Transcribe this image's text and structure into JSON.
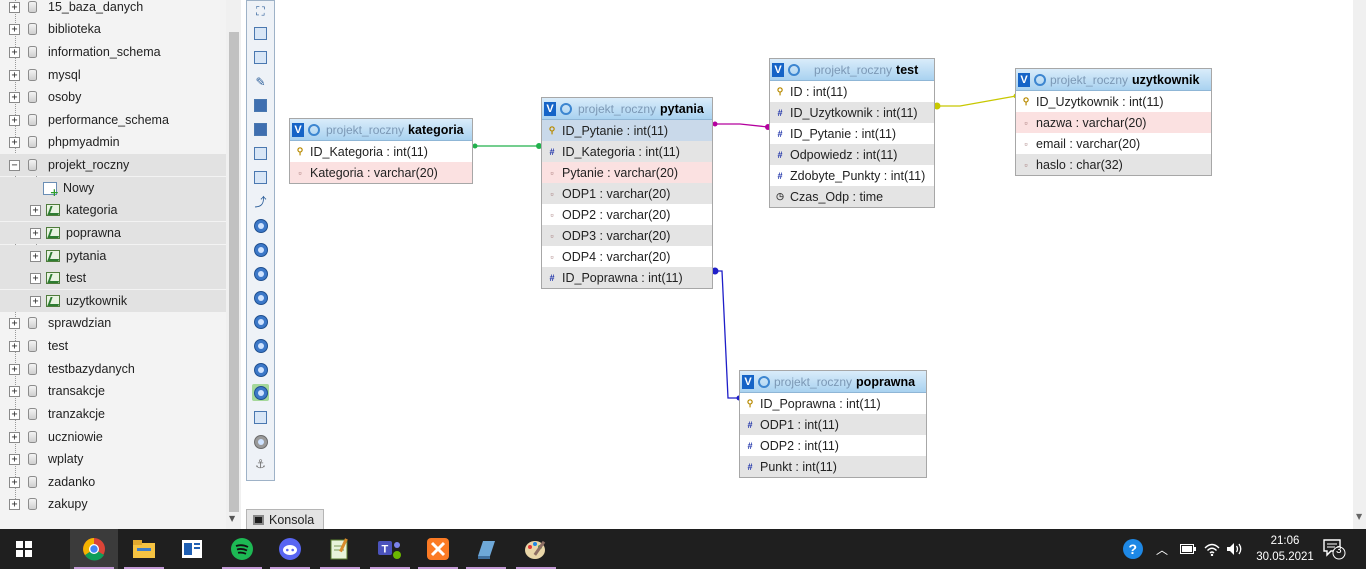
{
  "sidebar": {
    "databases_top": [
      "15_baza_danych",
      "biblioteka",
      "information_schema",
      "mysql",
      "osoby",
      "performance_schema",
      "phpmyadmin"
    ],
    "selected_db": "projekt_roczny",
    "new_label": "Nowy",
    "tables": [
      "kategoria",
      "poprawna",
      "pytania",
      "test",
      "uzytkownik"
    ],
    "databases_bottom": [
      "sprawdzian",
      "test",
      "testbazydanych",
      "transakcje",
      "tranzakcje",
      "uczniowie",
      "wplaty",
      "zadanko",
      "zakupy"
    ]
  },
  "designer": {
    "db_prefix": "projekt_roczny",
    "tables": {
      "kategoria": {
        "name": "kategoria",
        "columns": [
          "ID_Kategoria : int(11)",
          "Kategoria : varchar(20)"
        ]
      },
      "pytania": {
        "name": "pytania",
        "columns": [
          "ID_Pytanie : int(11)",
          "ID_Kategoria : int(11)",
          "Pytanie : varchar(20)",
          "ODP1 : varchar(20)",
          "ODP2 : varchar(20)",
          "ODP3 : varchar(20)",
          "ODP4 : varchar(20)",
          "ID_Poprawna : int(11)"
        ]
      },
      "test": {
        "name": "test",
        "columns": [
          "ID : int(11)",
          "ID_Uzytkownik : int(11)",
          "ID_Pytanie : int(11)",
          "Odpowiedz : int(11)",
          "Zdobyte_Punkty : int(11)",
          "Czas_Odp : time"
        ]
      },
      "uzytkownik": {
        "name": "uzytkownik",
        "columns": [
          "ID_Uzytkownik : int(11)",
          "nazwa : varchar(20)",
          "email : varchar(20)",
          "haslo : char(32)"
        ]
      },
      "poprawna": {
        "name": "poprawna",
        "columns": [
          "ID_Poprawna : int(11)",
          "ODP1 : int(11)",
          "ODP2 : int(11)",
          "Punkt : int(11)"
        ]
      }
    },
    "relation_colors": {
      "kategoria_pytania": "#22b14c",
      "pytania_test": "#b4009e",
      "test_uzytkownik": "#c8c800",
      "pytania_poprawna": "#1e1ec8"
    }
  },
  "console_tab": "Konsola",
  "taskbar": {
    "apps": [
      "start-icon",
      "chrome-icon",
      "file-explorer-icon",
      "news-icon",
      "spotify-icon",
      "discord-icon",
      "notepad-icon",
      "teams-icon",
      "xampp-icon",
      "app-icon",
      "paint-icon"
    ],
    "time": "21:06",
    "date": "30.05.2021",
    "notifications": "3"
  }
}
